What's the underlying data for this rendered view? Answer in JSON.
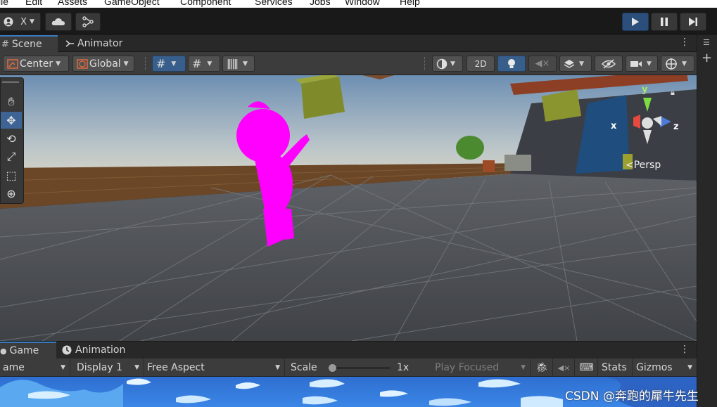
{
  "menubar": {
    "items": [
      "ile",
      "Edit",
      "Assets",
      "GameObject",
      "Component",
      "Services",
      "Jobs",
      "Window",
      "Help"
    ]
  },
  "toolbar": {
    "account_label": "X",
    "play_icon": "play-icon",
    "pause_icon": "pause-icon",
    "step_icon": "step-icon"
  },
  "scene_tabs": [
    {
      "label": "Scene",
      "icon": "hash-icon",
      "active": true
    },
    {
      "label": "Animator",
      "icon": "animator-icon",
      "active": false
    }
  ],
  "scene_toolbar": {
    "pivot_label": "Center",
    "space_label": "Global",
    "mode_2d_label": "2D"
  },
  "gizmo": {
    "y_label": "y",
    "x_label": "x",
    "z_label": "z",
    "projection_label": "Persp"
  },
  "game_tabs": [
    {
      "label": "Game",
      "icon": "game-icon",
      "active": true
    },
    {
      "label": "Animation",
      "icon": "animation-icon",
      "active": false
    }
  ],
  "game_toolbar": {
    "view_label": "ame",
    "display_label": "Display 1",
    "aspect_label": "Free Aspect",
    "scale_label": "Scale",
    "scale_value": "1x",
    "scale_fraction": 0.02,
    "play_focused_label": "Play Focused",
    "stats_label": "Stats",
    "gizmos_label": "Gizmos"
  },
  "watermark": "CSDN @奔跑的犀牛先生",
  "colors": {
    "accent_blue": "#3a79bb",
    "character_magenta": "#ff00ff",
    "sky_top": "#6d8fb3",
    "ground": "#4a4d52"
  }
}
